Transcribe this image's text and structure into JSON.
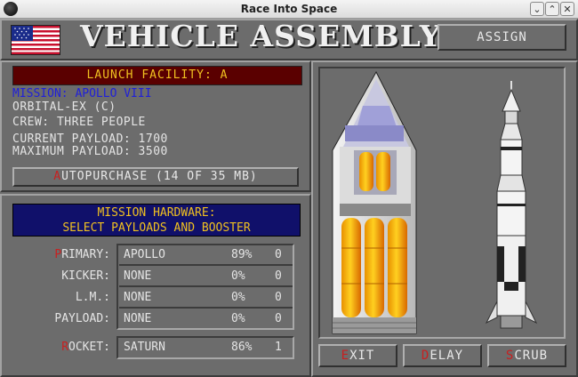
{
  "window": {
    "title": "Race Into Space"
  },
  "header": {
    "title": "VEHICLE ASSEMBLY",
    "assign_label": "ASSIGN"
  },
  "facility": {
    "label": "LAUNCH FACILITY: A"
  },
  "mission": {
    "name": "MISSION: APOLLO VIII",
    "type": "ORBITAL-EX (C)",
    "crew": "CREW: THREE PEOPLE",
    "current_payload": "CURRENT PAYLOAD: 1700",
    "max_payload": "MAXIMUM PAYLOAD: 3500"
  },
  "autopurchase": {
    "hot": "A",
    "rest": "UTOPURCHASE (14 OF 35 MB)"
  },
  "hardware": {
    "header_line1": "MISSION HARDWARE:",
    "header_line2": "SELECT PAYLOADS AND BOOSTER",
    "rows": [
      {
        "hot": "P",
        "label": "RIMARY:",
        "item": "APOLLO",
        "pct": "89%",
        "qty": "0"
      },
      {
        "hot": "",
        "label": "KICKER:",
        "item": "NONE",
        "pct": "0%",
        "qty": "0"
      },
      {
        "hot": "",
        "label": "L.M.:",
        "item": "NONE",
        "pct": "0%",
        "qty": "0"
      },
      {
        "hot": "",
        "label": "PAYLOAD:",
        "item": "NONE",
        "pct": "0%",
        "qty": "0"
      }
    ],
    "rocket": {
      "hot": "R",
      "label": "OCKET:",
      "item": "SATURN",
      "pct": "86%",
      "qty": "1"
    }
  },
  "buttons": {
    "exit": {
      "hot": "E",
      "rest": "XIT"
    },
    "delay": {
      "hot": "D",
      "rest": "ELAY"
    },
    "scrub": {
      "hot": "S",
      "rest": "CRUB"
    }
  },
  "colors": {
    "hotkey": "#c82020",
    "facility_bg": "#5a0000",
    "label_yellow": "#f0c020",
    "mission_blue": "#2020d8",
    "hw_header_bg": "#10106a"
  },
  "icons": [
    "app-icon",
    "us-flag",
    "spacecraft-cutaway",
    "saturn-rocket"
  ]
}
